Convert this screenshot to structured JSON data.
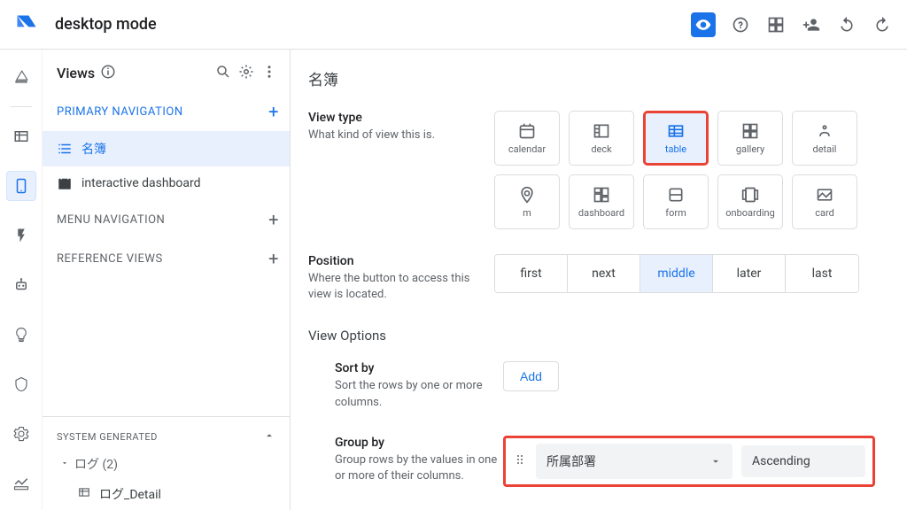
{
  "topbar": {
    "title": "desktop mode"
  },
  "views_panel": {
    "title": "Views",
    "sections": {
      "primary": {
        "label": "PRIMARY NAVIGATION"
      },
      "menu": {
        "label": "MENU NAVIGATION"
      },
      "reference": {
        "label": "REFERENCE VIEWS"
      }
    },
    "items": [
      {
        "label": "名簿"
      },
      {
        "label": "interactive dashboard"
      }
    ],
    "sysgen": {
      "label": "SYSTEM GENERATED",
      "group": "ログ (2)",
      "sub": "ログ_Detail"
    }
  },
  "main": {
    "view_name": "名簿",
    "view_type": {
      "title": "View type",
      "desc": "What kind of view this is.",
      "options": [
        "calendar",
        "deck",
        "table",
        "gallery",
        "detail",
        "m",
        "dashboard",
        "form",
        "onboarding",
        "card"
      ],
      "selected_index": 2
    },
    "position": {
      "title": "Position",
      "desc": "Where the button to access this view is located.",
      "options": [
        "first",
        "next",
        "middle",
        "later",
        "last"
      ],
      "selected_index": 2
    },
    "options_section": "View Options",
    "sort_by": {
      "title": "Sort by",
      "desc": "Sort the rows by one or more columns.",
      "add": "Add"
    },
    "group_by": {
      "title": "Group by",
      "desc": "Group rows by the values in one or more of their columns.",
      "value": "所属部署",
      "order": "Ascending"
    }
  }
}
